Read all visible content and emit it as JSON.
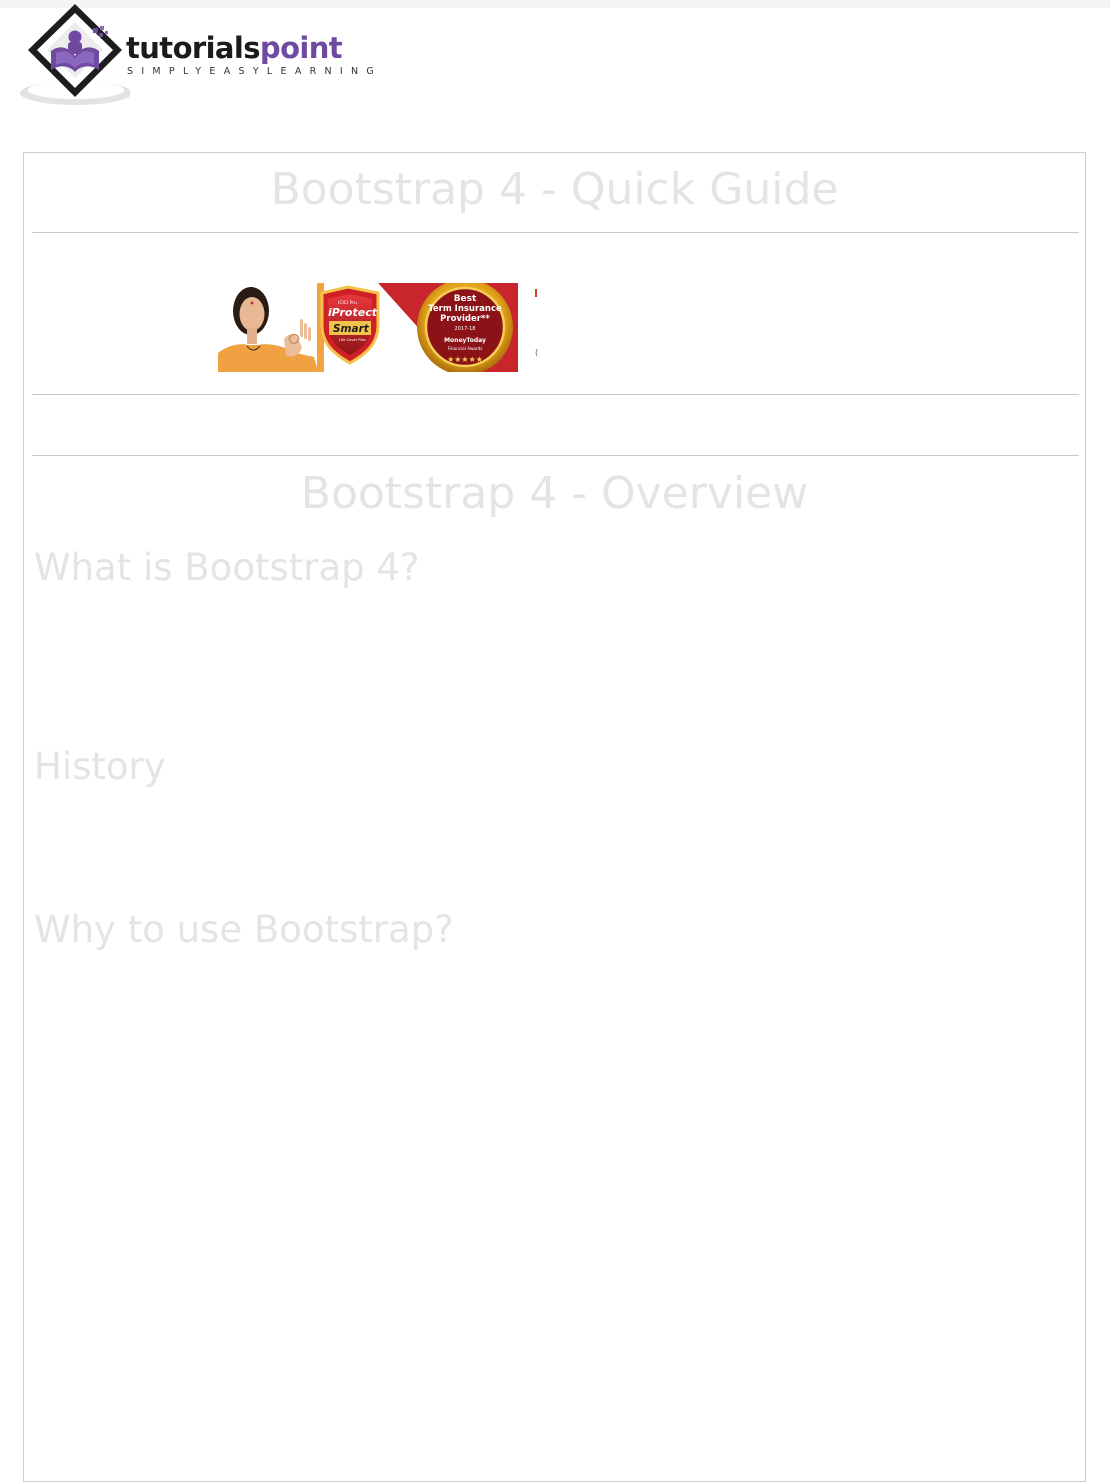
{
  "site": {
    "logo_word_part1": "tutorials",
    "logo_word_part2": "point",
    "logo_tagline": "SIMPLYEASYLEARNING",
    "brand_color": "#6f4aa0"
  },
  "page": {
    "title": "Bootstrap 4 - Quick Guide",
    "section_title": "Bootstrap 4 - Overview",
    "subheadings": [
      "What is Bootstrap 4?",
      "History",
      "Why to use Bootstrap?"
    ]
  },
  "ad": {
    "badge1_line1": "ICICI Pru",
    "badge1_line2": "iProtect",
    "badge1_line3": "Smart",
    "badge1_line4": "Life Cover Plan",
    "badge2_line1": "Best",
    "badge2_line2": "Term Insurance",
    "badge2_line3": "Provider**",
    "badge2_line4": "2017-18",
    "badge2_line5": "MoneyToday",
    "badge2_line6": "Financial Awards",
    "badge2_stars": "★★★★★",
    "badge_color": "#c8262c",
    "medal_color": "#e3a11a",
    "side_marker": "("
  },
  "colors": {
    "ghost_text": "#e4e4e4",
    "rule": "#c9c9c9",
    "frame_border": "#cfcfcf"
  }
}
